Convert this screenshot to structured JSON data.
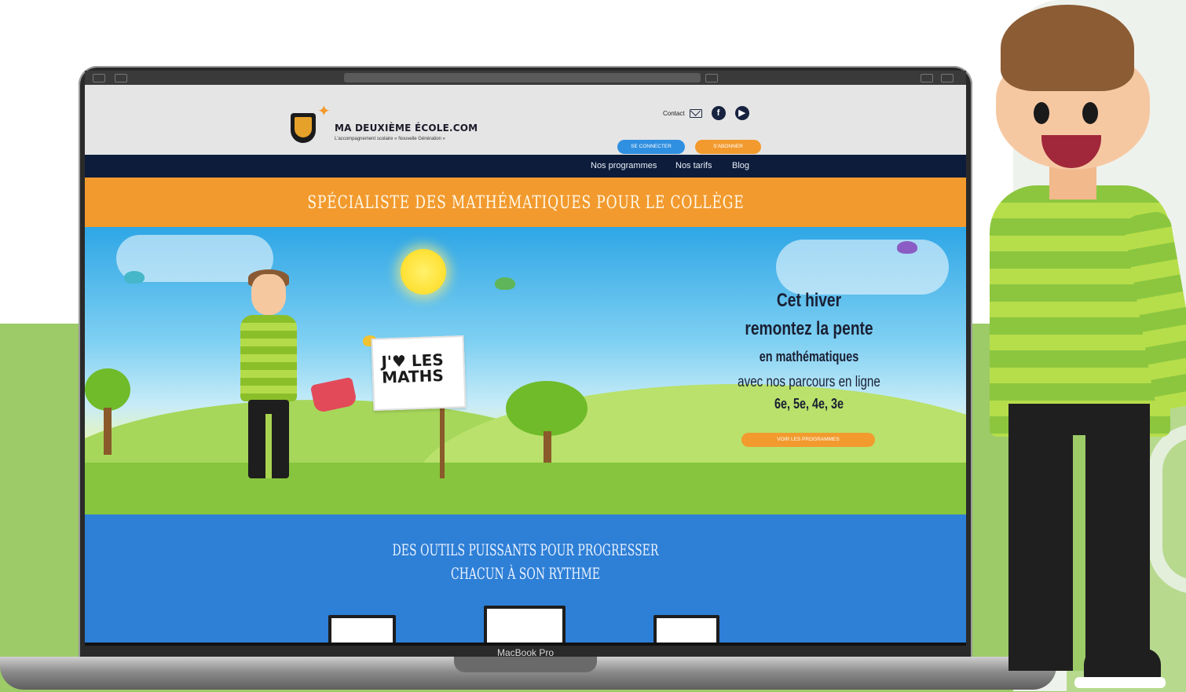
{
  "device_label": "MacBook Pro",
  "browser": {
    "url_text": ""
  },
  "site": {
    "logo_title": "MA DEUXIÈME ÉCOLE.COM",
    "logo_tagline": "L'accompagnement scolaire « Nouvelle Génération »",
    "contact_label": "Contact",
    "social_icons": [
      "mail-icon",
      "facebook-icon",
      "youtube-icon"
    ],
    "login_button": "SE CONNECTER",
    "signup_button": "S'ABONNER",
    "nav": [
      "Nos programmes",
      "Nos tarifs",
      "Blog"
    ],
    "banner": "SPÉCIALISTE DES MATHÉMATIQUES POUR LE COLLÈGE",
    "sign_text": "J'♥ LES\nMATHS",
    "hero": {
      "line1": "Cet hiver",
      "line2": "remontez la pente",
      "line3": "en mathématiques",
      "line4": "avec nos parcours en ligne",
      "line5": "6e, 5e, 4e, 3e",
      "cta": "VOIR LES PROGRAMMES"
    },
    "features_title_1": "DES OUTILS PUISSANTS POUR PROGRESSER",
    "features_title_2": "CHACUN À SON RYTHME"
  },
  "colors": {
    "orange": "#f29a2e",
    "navy": "#0d1c3b",
    "blue": "#2e7fd6",
    "green_bg": "#9ccb68",
    "button_blue": "#2f8fe0"
  }
}
